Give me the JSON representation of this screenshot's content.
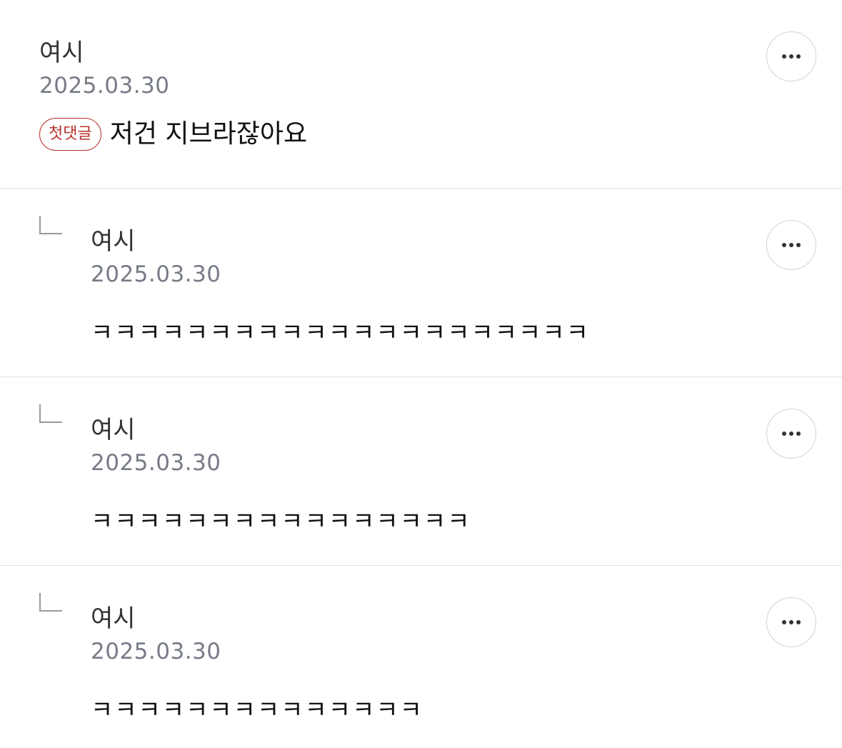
{
  "comments": [
    {
      "author": "여시",
      "date": "2025.03.30",
      "badge": "첫댓글",
      "text": "저건 지브라잖아요"
    },
    {
      "author": "여시",
      "date": "2025.03.30",
      "text": "ㅋㅋㅋㅋㅋㅋㅋㅋㅋㅋㅋㅋㅋㅋㅋㅋㅋㅋㅋㅋㅋ"
    },
    {
      "author": "여시",
      "date": "2025.03.30",
      "text": "ㅋㅋㅋㅋㅋㅋㅋㅋㅋㅋㅋㅋㅋㅋㅋㅋ"
    },
    {
      "author": "여시",
      "date": "2025.03.30",
      "text": "ㅋㅋㅋㅋㅋㅋㅋㅋㅋㅋㅋㅋㅋㅋ"
    }
  ],
  "icons": {
    "more": "more-horizontal-icon",
    "reply": "reply-arrow-icon"
  },
  "colors": {
    "badge": "#b5322a",
    "date": "#767b86",
    "divider": "#e3e3e3"
  }
}
